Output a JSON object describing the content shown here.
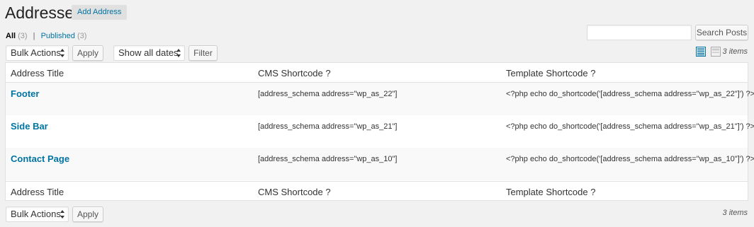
{
  "header": {
    "title": "Addresses",
    "add_button": "Add Address"
  },
  "filters": {
    "all_label": "All",
    "all_count": "(3)",
    "separator": "|",
    "published_label": "Published",
    "published_count": "(3)"
  },
  "search": {
    "placeholder": "",
    "value": "",
    "button": "Search Posts"
  },
  "toolbar_top": {
    "bulk_actions": "Bulk Actions",
    "apply": "Apply",
    "dates": "Show all dates",
    "filter": "Filter",
    "items": "3 items"
  },
  "toolbar_bottom": {
    "bulk_actions": "Bulk Actions",
    "apply": "Apply",
    "items": "3 items"
  },
  "view_modes": [
    "list-view-icon",
    "excerpt-view-icon"
  ],
  "colors": {
    "link": "#0074a2",
    "active_view": "#0074a2",
    "background": "#f1f1f1"
  },
  "table": {
    "columns": [
      "Address Title",
      "CMS Shortcode ?",
      "Template Shortcode ?"
    ],
    "rows": [
      {
        "title": "Footer",
        "cms": "[address_schema address=\"wp_as_22\"]",
        "template": "<?php echo do_shortcode('[address_schema address=\"wp_as_22\"]') ?>"
      },
      {
        "title": "Side Bar",
        "cms": "[address_schema address=\"wp_as_21\"]",
        "template": "<?php echo do_shortcode('[address_schema address=\"wp_as_21\"]') ?>"
      },
      {
        "title": "Contact Page",
        "cms": "[address_schema address=\"wp_as_10\"]",
        "template": "<?php echo do_shortcode('[address_schema address=\"wp_as_10\"]') ?>"
      }
    ]
  }
}
